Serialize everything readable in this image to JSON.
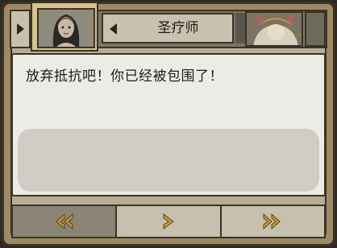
{
  "header": {
    "speaker_name": "圣疗师"
  },
  "dialogue": {
    "text": "放弃抵抗吧！你已经被包围了！"
  },
  "controls": {
    "rewind_icon": "double-chevron-left-icon",
    "next_icon": "chevron-right-icon",
    "skip_icon": "double-chevron-right-icon"
  },
  "colors": {
    "frame": "#a08a66",
    "accent_gold": "#c59a3c",
    "dialogue_bg": "#ecebe6"
  }
}
